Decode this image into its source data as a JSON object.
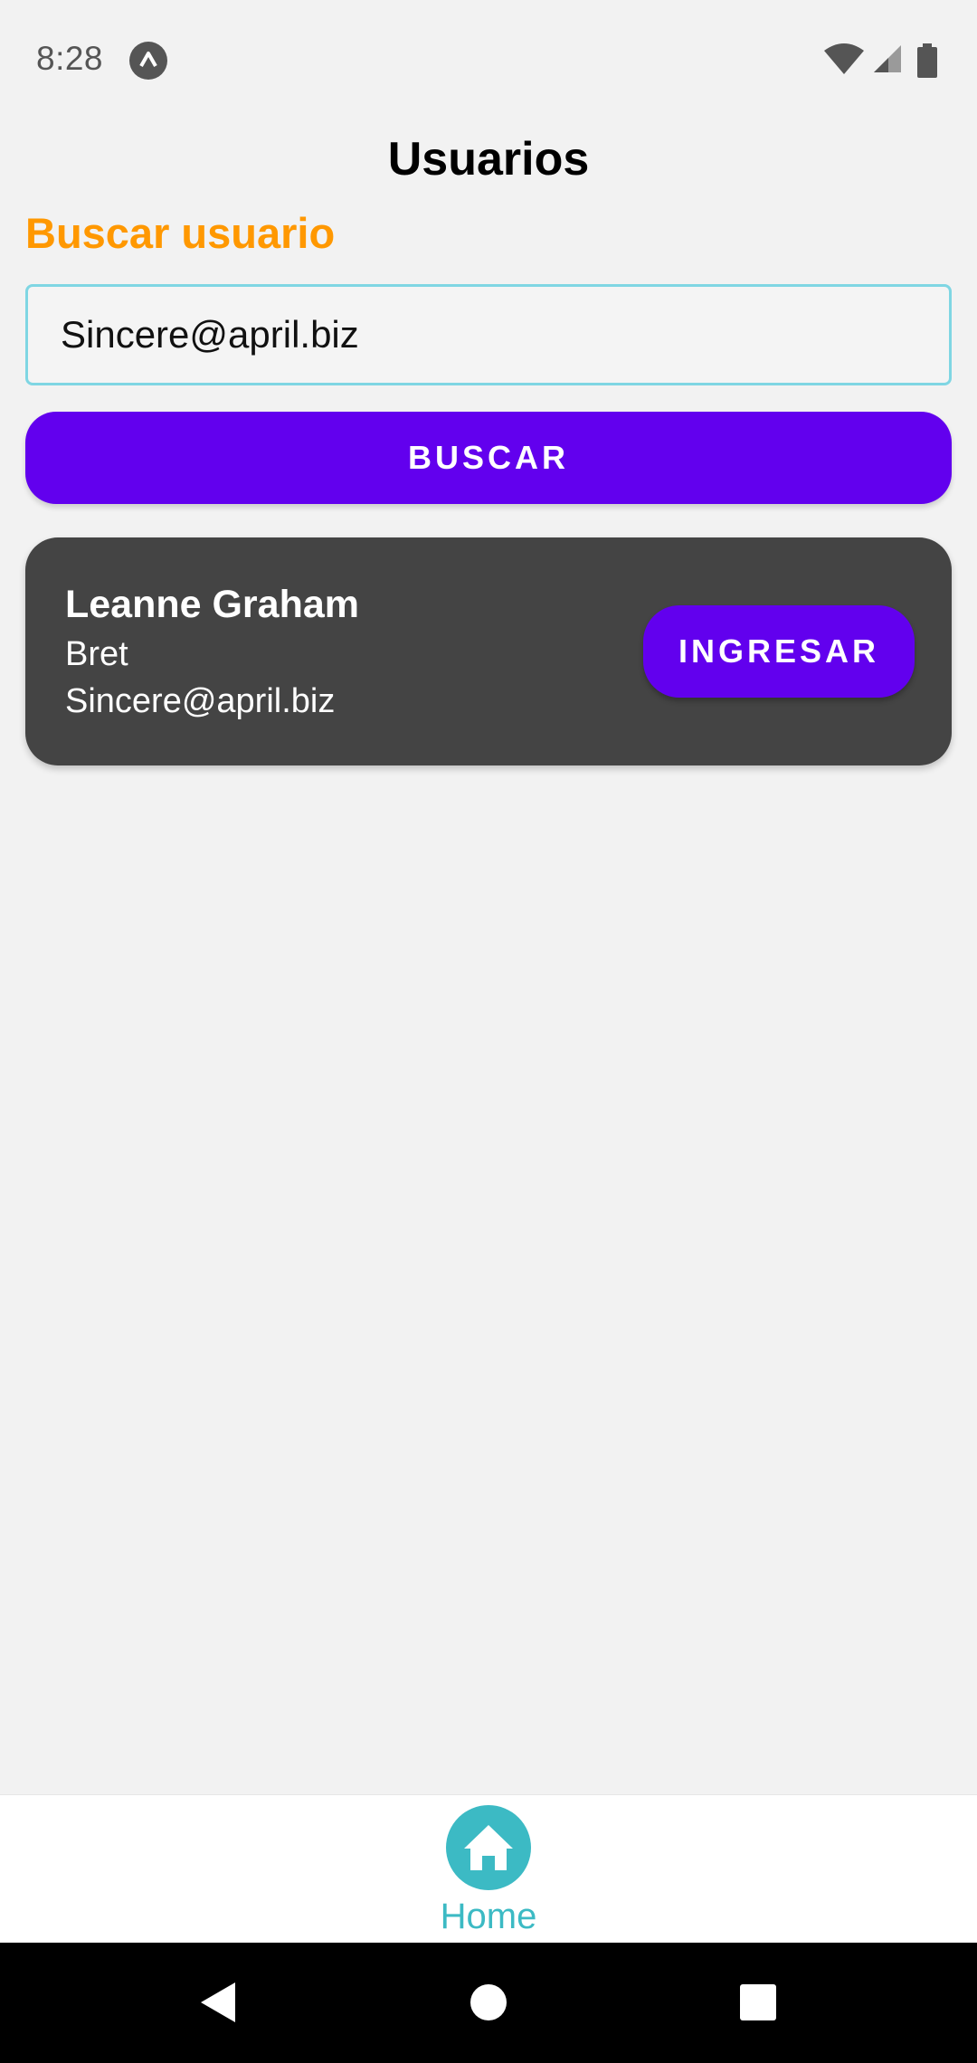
{
  "status_bar": {
    "time": "8:28",
    "app_icon": "expo-caret-icon",
    "icons": [
      "wifi-icon",
      "signal-icon",
      "battery-icon"
    ]
  },
  "header": {
    "title": "Usuarios"
  },
  "search": {
    "label": "Buscar usuario",
    "value": "Sincere@april.biz",
    "button_label": "BUSCAR"
  },
  "results": [
    {
      "name": "Leanne Graham",
      "username": "Bret",
      "email": "Sincere@april.biz",
      "button_label": "INGRESAR"
    }
  ],
  "tab_bar": {
    "home": {
      "label": "Home",
      "icon": "home-icon",
      "active": true
    }
  },
  "nav_bar": {
    "icons": [
      "back-icon",
      "home-circle-icon",
      "recents-icon"
    ]
  },
  "colors": {
    "accent": "#6200ee",
    "label_orange": "#ff9800",
    "tab_active": "#3cbac4",
    "card_bg": "#444444",
    "input_border": "#7fd6e3"
  }
}
